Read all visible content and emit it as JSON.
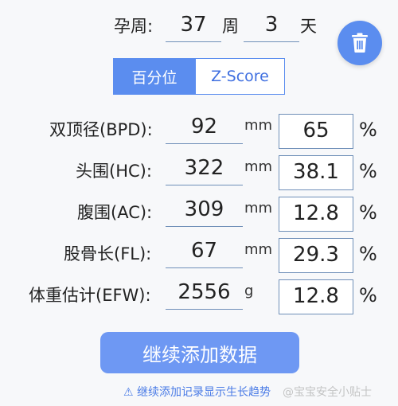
{
  "gestation": {
    "label": "孕周:",
    "weeks": "37",
    "weeks_unit": "周",
    "days": "3",
    "days_unit": "天"
  },
  "toolbar": {
    "delete_icon": "trash-icon"
  },
  "tabs": [
    {
      "label": "百分位",
      "active": true
    },
    {
      "label": "Z-Score",
      "active": false
    }
  ],
  "rows": [
    {
      "label": "双顶径(BPD):",
      "value": "92",
      "unit": "mm",
      "score": "65",
      "score_unit": "%"
    },
    {
      "label": "头围(HC):",
      "value": "322",
      "unit": "mm",
      "score": "38.1",
      "score_unit": "%"
    },
    {
      "label": "腹围(AC):",
      "value": "309",
      "unit": "mm",
      "score": "12.8",
      "score_unit": "%"
    },
    {
      "label": "股骨长(FL):",
      "value": "67",
      "unit": "mm",
      "score": "29.3",
      "score_unit": "%"
    },
    {
      "label": "体重估计(EFW):",
      "value": "2556",
      "unit": "g",
      "score": "12.8",
      "score_unit": "%"
    }
  ],
  "actions": {
    "add_label": "继续添加数据"
  },
  "hint": {
    "icon": "warning-icon",
    "text": "⚠ 继续添加记录显示生长趋势"
  },
  "watermark": "@宝宝安全小贴士",
  "colors": {
    "accent": "#5b8def",
    "underline": "#6f8fb8"
  }
}
